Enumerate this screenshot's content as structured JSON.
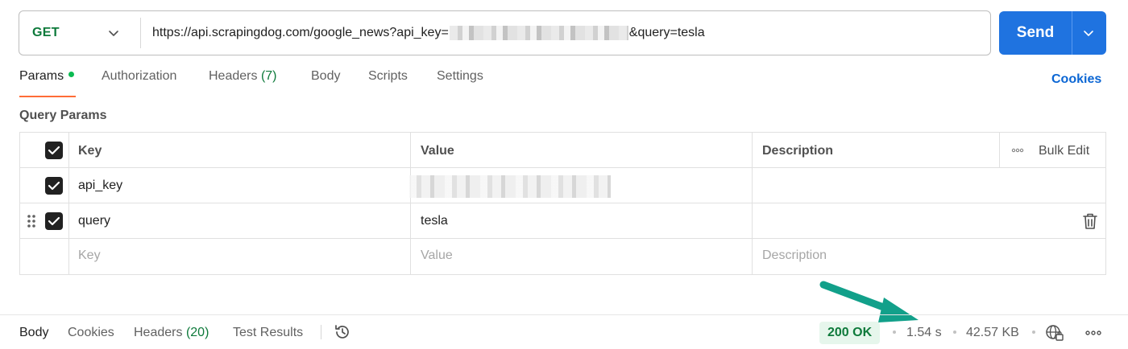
{
  "request": {
    "method": "GET",
    "url_prefix": "https://api.scrapingdog.com/google_news?api_key=",
    "url_suffix": "&query=tesla",
    "send_label": "Send"
  },
  "tabs": [
    {
      "label": "Params"
    },
    {
      "label": "Authorization"
    },
    {
      "label": "Headers",
      "count": "(7)"
    },
    {
      "label": "Body"
    },
    {
      "label": "Scripts"
    },
    {
      "label": "Settings"
    }
  ],
  "cookies_link": "Cookies",
  "section_title": "Query Params",
  "table": {
    "headers": {
      "key": "Key",
      "value": "Value",
      "description": "Description",
      "bulk_edit": "Bulk Edit"
    },
    "rows": [
      {
        "key": "api_key",
        "value": "",
        "description": "",
        "checked": true
      },
      {
        "key": "query",
        "value": "tesla",
        "description": "",
        "checked": true
      }
    ],
    "placeholders": {
      "key": "Key",
      "value": "Value",
      "description": "Description"
    }
  },
  "response": {
    "tabs": [
      {
        "label": "Body"
      },
      {
        "label": "Cookies"
      },
      {
        "label": "Headers",
        "count": "(20)"
      },
      {
        "label": "Test Results"
      }
    ],
    "status": "200 OK",
    "time": "1.54 s",
    "size": "42.57 KB"
  },
  "colors": {
    "accent": "#1f73e0",
    "method_green": "#0e7a3b",
    "active_tab_underline": "#ff6c37",
    "annotation_arrow": "#12a08a"
  }
}
